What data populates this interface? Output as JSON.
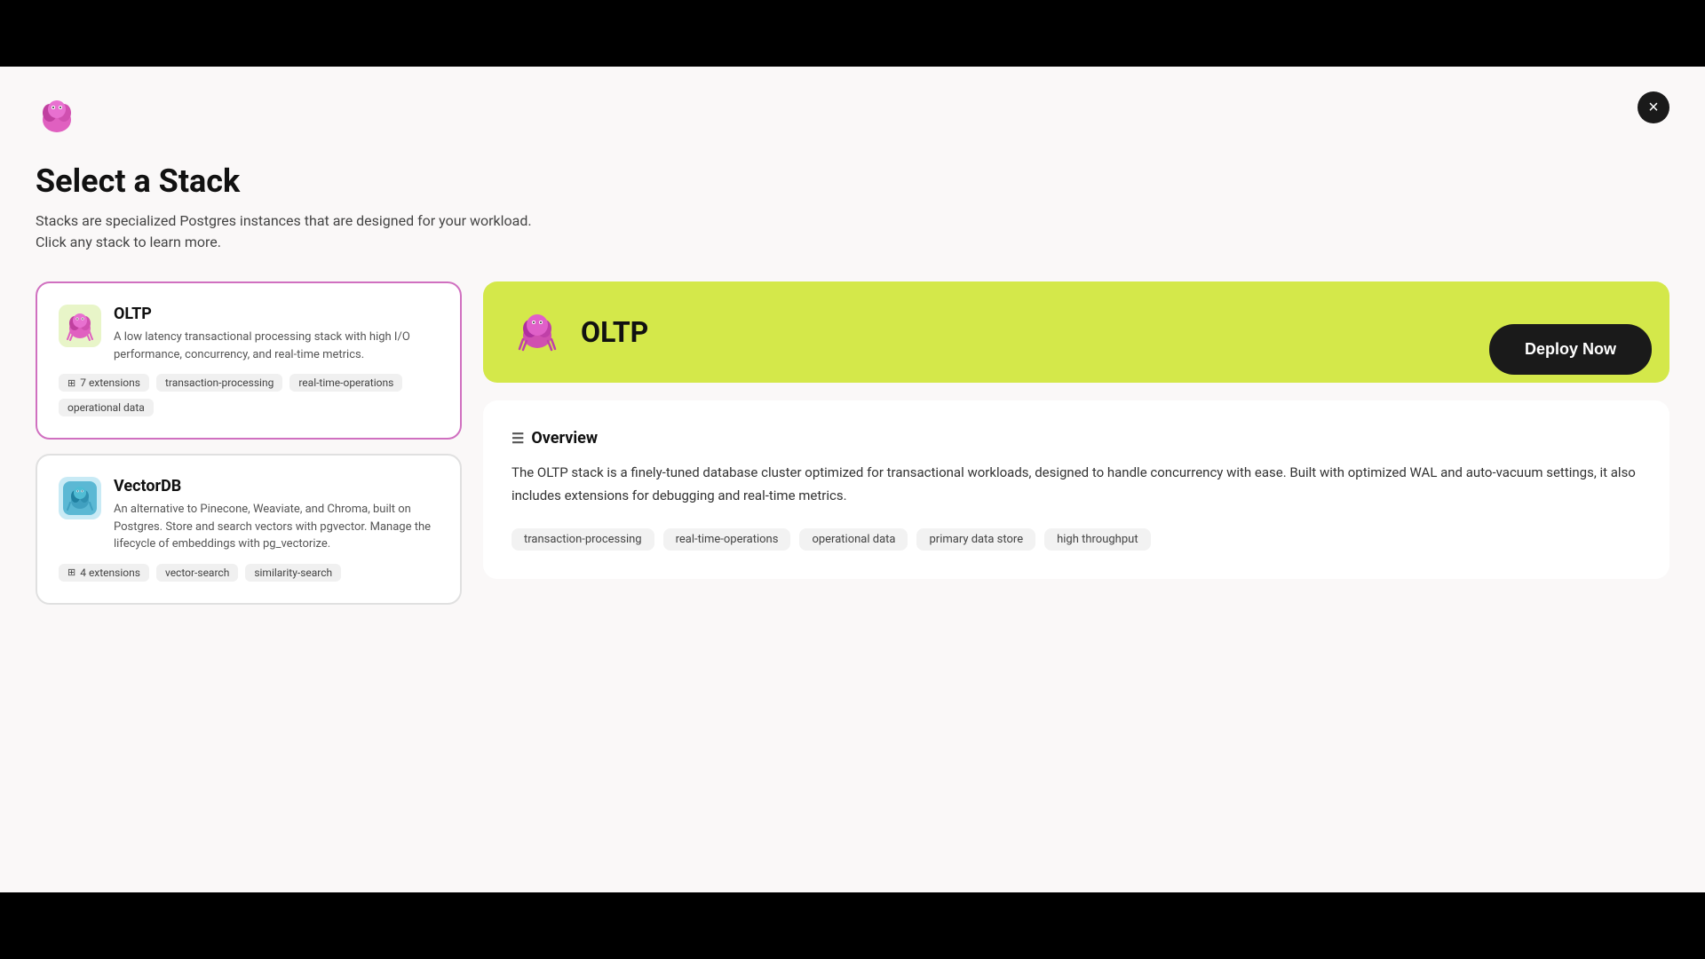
{
  "app": {
    "logo_alt": "TablePlus logo"
  },
  "header": {
    "title": "Select a Stack",
    "subtitle": "Stacks are specialized Postgres instances that are designed for your workload. Click any stack to learn more.",
    "deploy_button": "Deploy Now",
    "close_button": "×"
  },
  "stacks": [
    {
      "id": "oltp",
      "name": "OLTP",
      "description": "A low latency transactional processing stack with high I/O performance, concurrency, and real-time metrics.",
      "icon_color": "#e8f5c8",
      "icon_emoji": "🐙",
      "tags": [
        {
          "label": "7 extensions",
          "type": "ext"
        },
        {
          "label": "transaction-processing",
          "type": "plain"
        },
        {
          "label": "real-time-operations",
          "type": "plain"
        },
        {
          "label": "operational data",
          "type": "plain"
        }
      ],
      "selected": true
    },
    {
      "id": "vectordb",
      "name": "VectorDB",
      "description": "An alternative to Pinecone, Weaviate, and Chroma, built on Postgres. Store and search vectors with pgvector. Manage the lifecycle of embeddings with pg_vectorize.",
      "icon_color": "#c8eaf5",
      "icon_emoji": "🐙",
      "tags": [
        {
          "label": "4 extensions",
          "type": "ext"
        },
        {
          "label": "vector-search",
          "type": "plain"
        },
        {
          "label": "similarity-search",
          "type": "plain"
        }
      ],
      "selected": false
    }
  ],
  "detail": {
    "stack_name": "OLTP",
    "icon_emoji": "🐙",
    "overview_title": "Overview",
    "overview_icon": "☰",
    "description": "The OLTP stack is a finely-tuned database cluster optimized for transactional workloads, designed to handle concurrency with ease. Built with optimized WAL and auto-vacuum settings, it also includes extensions for debugging and real-time metrics.",
    "tags": [
      "transaction-processing",
      "real-time-operations",
      "operational data",
      "primary data store",
      "high throughput"
    ]
  }
}
